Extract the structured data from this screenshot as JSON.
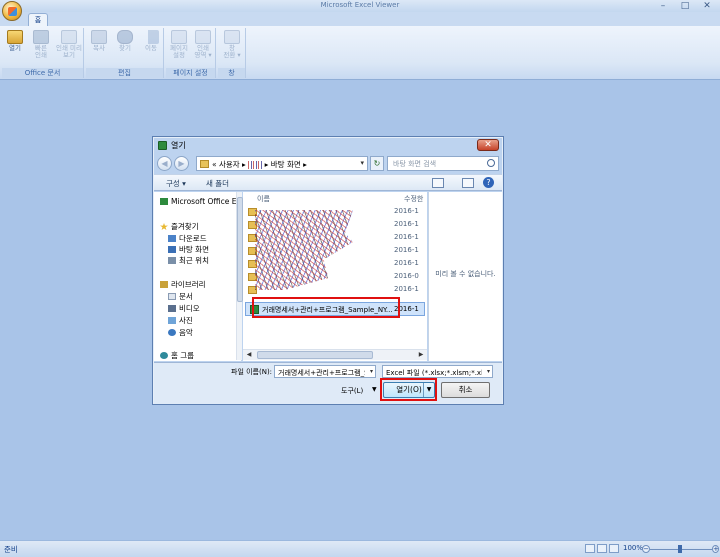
{
  "window": {
    "title": "Microsoft Excel Viewer",
    "min": "–",
    "max": "□",
    "close": "✕"
  },
  "tabs": {
    "home": "홈"
  },
  "ribbon": {
    "office_group": {
      "name": "Office 문서",
      "open": "열기",
      "quick_print": [
        "빠른",
        "인쇄"
      ],
      "print_preview": [
        "인쇄 미리",
        "보기"
      ]
    },
    "edit_group": {
      "name": "편집",
      "copy": "복사",
      "find": "찾기",
      "goto": "이동"
    },
    "page_group": {
      "name": "페이지 설정",
      "page_setup": [
        "페이지",
        "설정"
      ],
      "print_area": [
        "인쇄",
        "영역 ▾"
      ]
    },
    "window_group": {
      "name": "창",
      "switch": [
        "창",
        "전환 ▾"
      ]
    }
  },
  "status": {
    "ready": "준비",
    "zoom": "100%"
  },
  "dialog": {
    "title": "열기",
    "close": "✕",
    "path": {
      "prefix": "«  사용자  ▸",
      "tail": "▸  바탕 화면  ▸"
    },
    "search_placeholder": "바탕 화면 검색",
    "toolbar": {
      "organize": "구성 ▾",
      "new_folder": "새 폴더"
    },
    "nav": {
      "office": "Microsoft Office E",
      "favorites": "즐겨찾기",
      "downloads": "다운로드",
      "desktop": "바탕 화면",
      "recent": "최근 위치",
      "libraries": "라이브러리",
      "documents": "문서",
      "videos": "비디오",
      "pictures": "사진",
      "music": "음악",
      "homegroup": "홈 그룹"
    },
    "columns": {
      "name": "이름",
      "modified": "수정한"
    },
    "folder_dates": [
      "2016-1",
      "2016-1",
      "2016-1",
      "2016-1",
      "2016-1",
      "2016-0",
      "2016-1",
      "2016-1"
    ],
    "selected_file": {
      "name": "거래명세서+관리+프로그램_Sample_NY...",
      "date": "2016-1"
    },
    "preview_message": "미리 볼 수 없습니다.",
    "filename_label": "파일 이름(N):",
    "filename_value": "거래명세서+관리+프로그램_S",
    "filetype_value": "Excel 파일 (*.xlsx;*.xlsm;*.xlsb;",
    "tools_label": "도구(L)",
    "open_button": "열기(O)",
    "cancel_button": "취소"
  }
}
